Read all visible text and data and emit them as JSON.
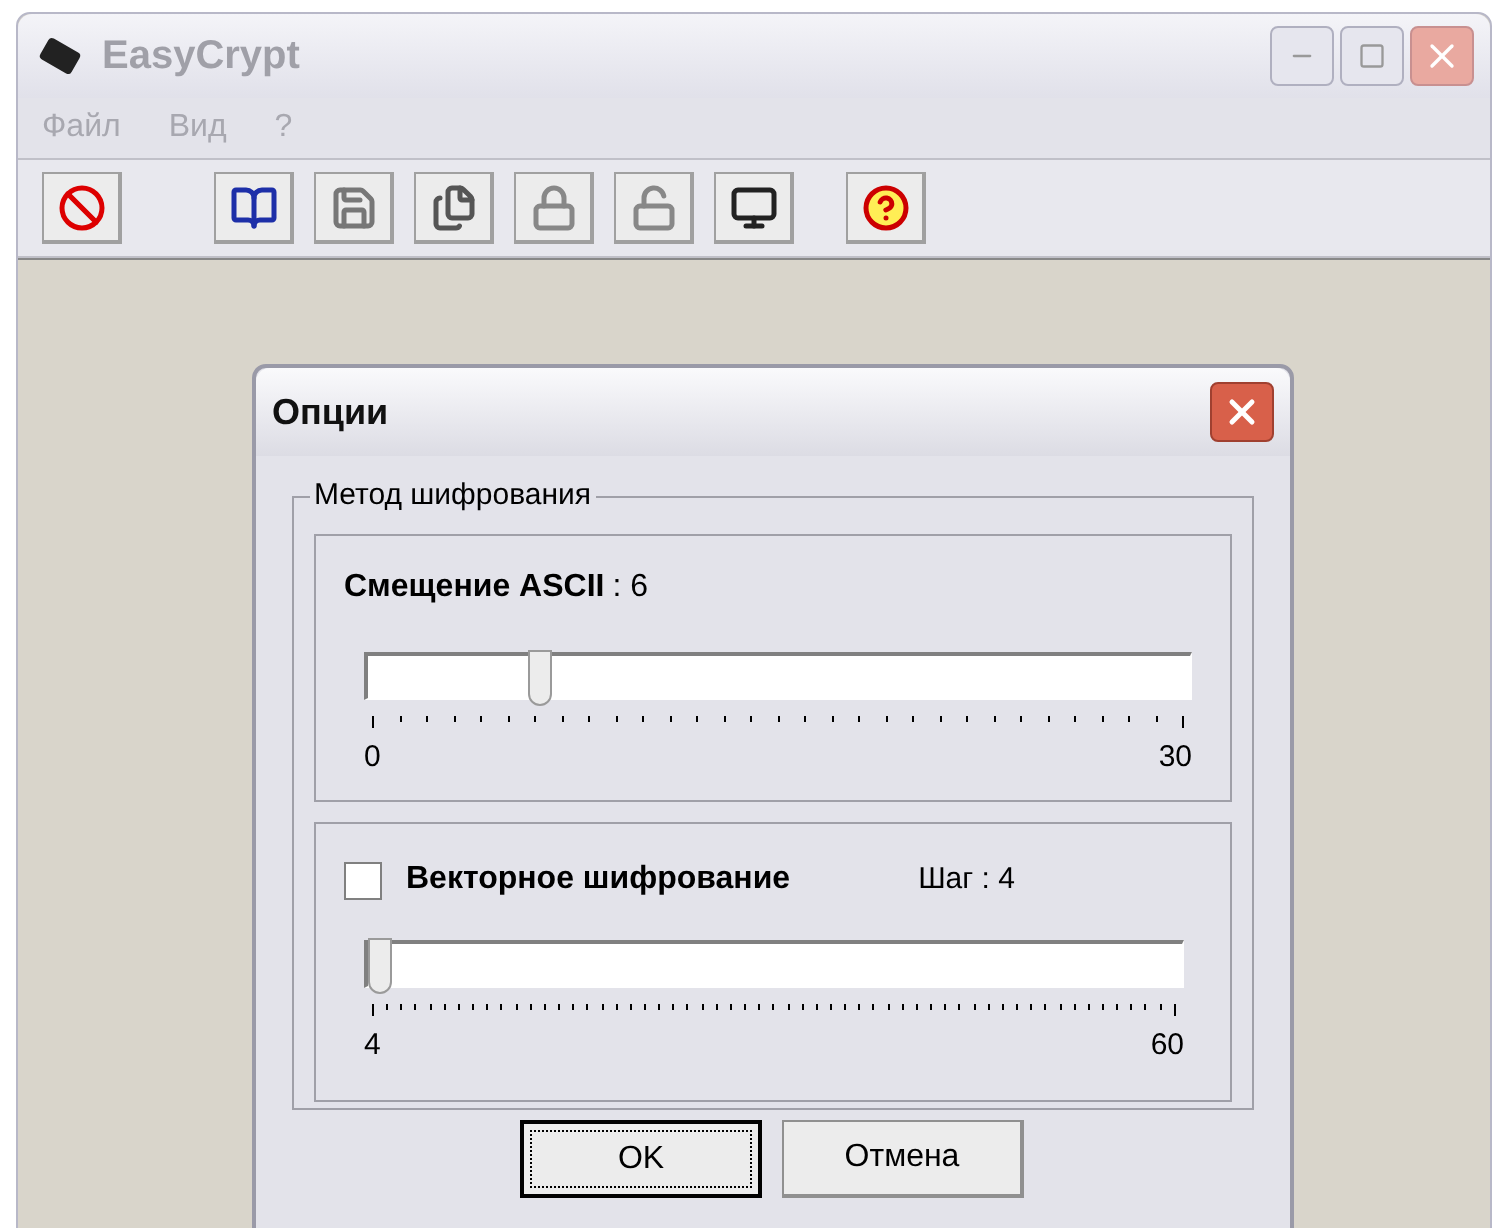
{
  "window": {
    "title": "EasyCrypt"
  },
  "menu": [
    {
      "label": "Файл"
    },
    {
      "label": "Вид"
    },
    {
      "label": "?"
    }
  ],
  "toolbar": [
    {
      "kind": "stop"
    },
    {
      "kind": "book"
    },
    {
      "kind": "save"
    },
    {
      "kind": "copy"
    },
    {
      "kind": "lock"
    },
    {
      "kind": "unlock"
    },
    {
      "kind": "computer"
    },
    {
      "kind": "help"
    }
  ],
  "dialog": {
    "title": "Опции",
    "group_label": "Метод шифрования",
    "ascii": {
      "label": "Смещение ASCII",
      "reading": ": 6",
      "level": 0.2,
      "min": "0",
      "max": "30"
    },
    "vector": {
      "label": "Векторное шифрование",
      "checked": false,
      "reading": "Шаг : 4",
      "level": 0,
      "min": "4",
      "max": "60"
    },
    "buttons": [
      {
        "label": "OK",
        "selected": true
      },
      {
        "label": "Отмена",
        "selected": false
      }
    ]
  }
}
